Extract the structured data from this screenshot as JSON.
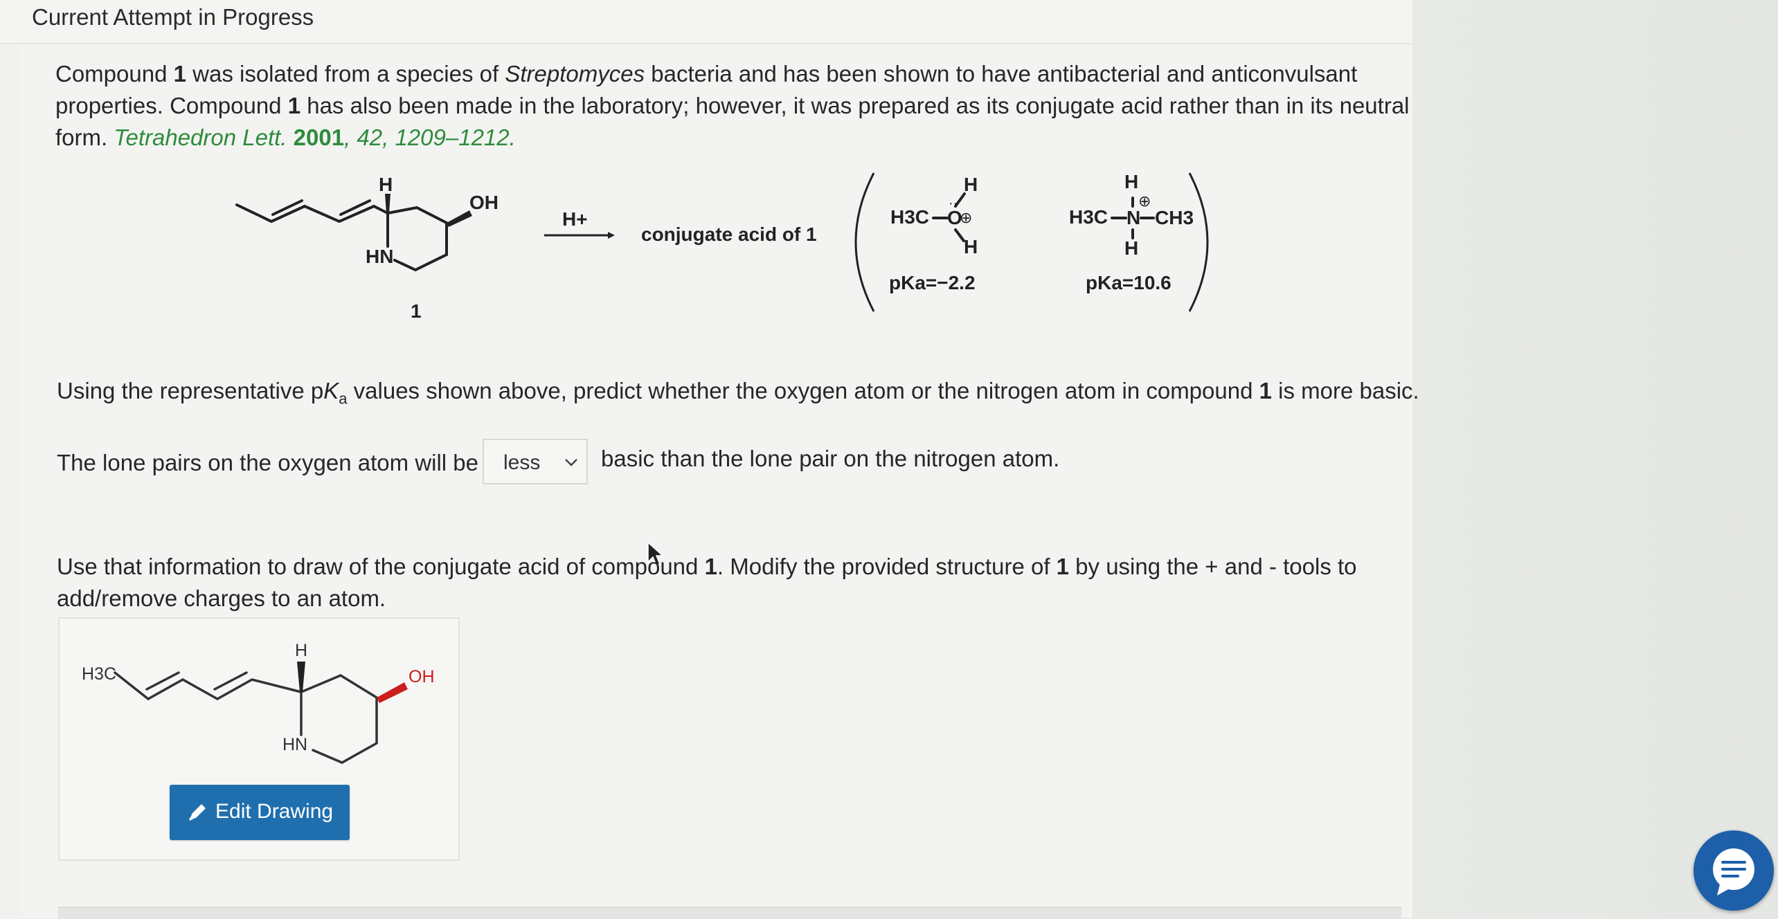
{
  "header": {
    "title": "Current Attempt in Progress"
  },
  "intro": {
    "part1": "Compound ",
    "num1": "1",
    "part2": " was isolated from a species of ",
    "species": "Streptomyces",
    "part3": " bacteria and has been shown to have antibacterial and anticonvulsant",
    "line2a": "properties. Compound ",
    "num2": "1",
    "line2b": " has also been made in the laboratory; however, it was prepared as its conjugate acid rather than in its neutral",
    "line3": "form. ",
    "citation": {
      "journal": "Tetrahedron Lett.",
      "year": "2001",
      "rest": ", 42, 1209–1212."
    }
  },
  "scheme": {
    "compound_label": "1",
    "oh_label": "OH",
    "h_label": "H",
    "hn_label": "HN",
    "arrow_reagent": "H+",
    "product_text": "conjugate acid of 1",
    "examples": [
      {
        "formula_left": "H3C",
        "atom": "O",
        "pka_label": "pKa",
        "pka_value": "=−2.2"
      },
      {
        "formula_left": "H3C",
        "atom": "N",
        "formula_right": "CH3",
        "pka_label": "pKa",
        "pka_value": "=10.6"
      }
    ]
  },
  "question1": {
    "text_a": "Using the representative p",
    "text_k": "K",
    "text_sub": "a",
    "text_b": " values shown above, predict whether the oxygen atom or the nitrogen atom in compound ",
    "num": "1",
    "text_c": " is more basic."
  },
  "answer": {
    "prefix": "The lone pairs on the oxygen atom will be",
    "selected": "less",
    "suffix": "basic than the lone pair on the nitrogen atom."
  },
  "question2": {
    "line1a": "Use that information to draw of the conjugate acid of compound ",
    "num1": "1",
    "line1b": ". Modify the provided structure of ",
    "num2": "1",
    "line1c": " by using the + and - tools to",
    "line2": "add/remove charges to an atom."
  },
  "drawing": {
    "ch3_label": "H3C",
    "h_label": "H",
    "hn_label": "HN",
    "oh_label": "OH",
    "edit_button": "Edit Drawing"
  },
  "colors": {
    "accent": "#1f6fae",
    "citation": "#2e8b3d",
    "stereo_wedge": "#cc1e1e",
    "chat": "#1d5fa8"
  },
  "icons": [
    "pencil-icon",
    "chevron-down-icon",
    "chat-icon",
    "mouse-cursor-icon"
  ]
}
